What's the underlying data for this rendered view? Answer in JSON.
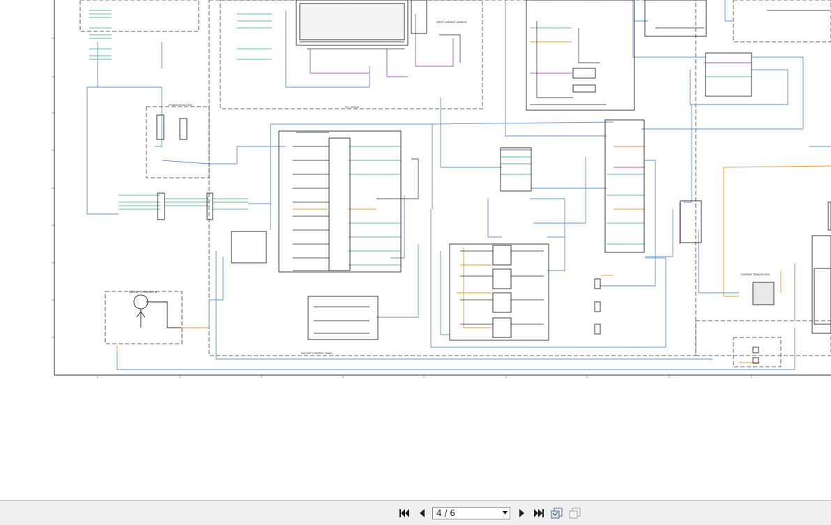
{
  "viewer": {
    "page_indicator": "4 / 6",
    "accent_color": "#1f1f1f"
  },
  "toolbar": {
    "buttons": [
      {
        "name": "first-page-button",
        "icon": "skip-to-start-icon"
      },
      {
        "name": "previous-page-button",
        "icon": "triangle-left-icon"
      },
      {
        "name": "next-page-button",
        "icon": "triangle-right-icon"
      },
      {
        "name": "last-page-button",
        "icon": "skip-to-end-icon"
      },
      {
        "name": "copy-page-button",
        "icon": "copy-page-icon"
      },
      {
        "name": "pages-disabled-button",
        "icon": "pages-icon"
      }
    ]
  },
  "schematic": {
    "colors": {
      "wire_blue": "#5b8fd0",
      "wire_orange": "#e39a2d",
      "wire_purple": "#a455b8",
      "wire_teal": "#2aa39a",
      "wire_green": "#3f9b4a",
      "line_black": "#1f1f1f"
    },
    "labels": {
      "power_resistors": "POWER RESISTORS",
      "plc_group": "PLC GROUP",
      "magnet_control_panel": "MAGNET CONTROL PANEL",
      "magnet_termination": "MAGNET TERMINATION",
      "drop_current_sensor": "DROP CURRENT SENSOR",
      "current_transducer": "CURRENT TRANSDUCER"
    }
  }
}
